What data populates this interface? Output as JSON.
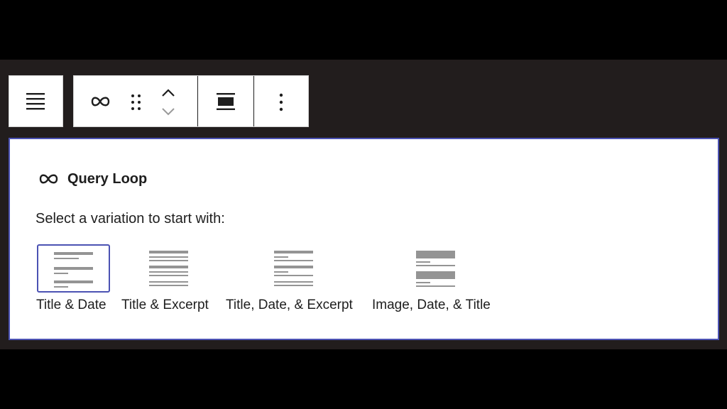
{
  "block_toolbar": {
    "parent_icon": "align-left-icon",
    "block_icon": "query-loop-icon",
    "drag_icon": "drag-handle-icon",
    "move_up_icon": "chevron-up-icon",
    "move_down_icon": "chevron-down-icon",
    "align_icon": "align-full-width-icon",
    "options_icon": "more-vertical-icon"
  },
  "placeholder": {
    "title": "Query Loop",
    "title_icon": "query-loop-icon",
    "instructions": "Select a variation to start with:",
    "variations": [
      {
        "label": "Title & Date",
        "selected": true
      },
      {
        "label": "Title & Excerpt",
        "selected": false
      },
      {
        "label": "Title, Date, & Excerpt",
        "selected": false
      },
      {
        "label": "Image, Date, & Title",
        "selected": false
      }
    ]
  },
  "colors": {
    "accent": "#4b52b3",
    "background": "#221d1d",
    "text": "#1e1e1e",
    "preview_lines": "#949494"
  }
}
